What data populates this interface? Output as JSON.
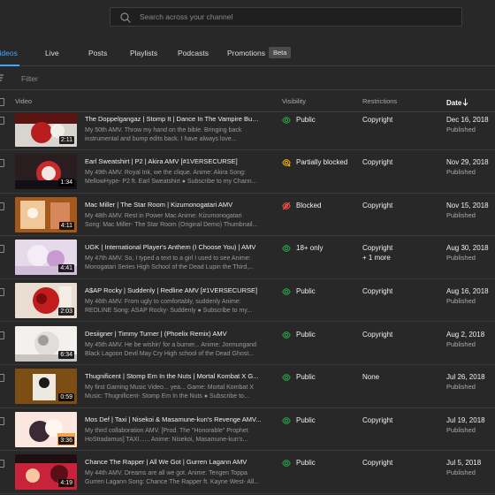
{
  "search": {
    "placeholder": "Search across your channel"
  },
  "tabs": [
    {
      "label": "Videos",
      "active": true
    },
    {
      "label": "Live"
    },
    {
      "label": "Posts"
    },
    {
      "label": "Playlists"
    },
    {
      "label": "Podcasts"
    },
    {
      "label": "Promotions",
      "badge": "Beta"
    }
  ],
  "filter": {
    "placeholder": "Filter"
  },
  "columns": {
    "video": "Video",
    "visibility": "Visibility",
    "restrictions": "Restrictions",
    "date": "Date"
  },
  "colors": {
    "accent": "#3ea6ff",
    "public": "#2ba640",
    "partially_blocked": "#f6b400",
    "blocked": "#ff4e45"
  },
  "rows": [
    {
      "title": "The Doppelgangaz | Stomp It | Dance In The Vampire Bundle",
      "desc1": "My 50th AMV. Throw my hand on the bible. Bringing back",
      "desc2": "instrumental and bump edits back. I have always love...",
      "duration": "2:11",
      "visibility": "Public",
      "vis_icon": "eye-icon",
      "restriction": "Copyright",
      "restriction2": "",
      "date": "Dec 16, 2018",
      "status": "Published"
    },
    {
      "title": "Earl Sweatshirt | P2 | Akira AMV [#1VERSECURSE]",
      "desc1": "My 49th AMV. Royal Ink, we the clique. Anime: Akira Song:",
      "desc2": "MellowHype- P2 ft. Earl Sweatshirt ● Subscribe to my Chann...",
      "duration": "1:34",
      "visibility": "Partially blocked",
      "vis_icon": "eye-partial-icon",
      "restriction": "Copyright",
      "restriction2": "",
      "date": "Nov 29, 2018",
      "status": "Published"
    },
    {
      "title": "Mac Miller | The Star Room | Kizumonogatari AMV",
      "desc1": "My 48th AMV. Rest in Power Mac Anime: Kizumonogatari",
      "desc2": "Song: Mac Miller- The Star Room (Original Demo) Thumbnail...",
      "duration": "4:11",
      "visibility": "Blocked",
      "vis_icon": "eye-off-icon",
      "restriction": "Copyright",
      "restriction2": "",
      "date": "Nov 15, 2018",
      "status": "Published"
    },
    {
      "title": "UGK | International Player's Anthem (I Choose You) | AMV",
      "desc1": "My 47th AMV. So, I typed a text to a girl I used to see Anime:",
      "desc2": "Monogatari Series High School of the Dead Lupin the Third,...",
      "duration": "4:41",
      "visibility": "18+ only",
      "vis_icon": "eye-icon",
      "restriction": "Copyright",
      "restriction2": "+ 1 more",
      "date": "Aug 30, 2018",
      "status": "Published"
    },
    {
      "title": "A$AP Rocky | Suddenly | Redline AMV [#1VERSECURSE]",
      "desc1": "My 46th AMV. From ugly to comfortably, suddenly Anime:",
      "desc2": "REDLINE Song: ASAP Rocky- Suddenly ● Subscribe to my...",
      "duration": "2:03",
      "visibility": "Public",
      "vis_icon": "eye-icon",
      "restriction": "Copyright",
      "restriction2": "",
      "date": "Aug 16, 2018",
      "status": "Published"
    },
    {
      "title": "Desiigner | Timmy Turner | (Phoelix Remix) AMV",
      "desc1": "My 45th AMV. He be wishin' for a burner... Anime: Jormungand",
      "desc2": "Black Lagoon Devil May Cry High school of the Dead Ghost...",
      "duration": "6:34",
      "visibility": "Public",
      "vis_icon": "eye-icon",
      "restriction": "Copyright",
      "restriction2": "",
      "date": "Aug 2, 2018",
      "status": "Published"
    },
    {
      "title": "Thugnificent | Stomp Em In the Nuts | Mortal Kombat X G...",
      "desc1": "My first Gaming Music Video... yea... Game: Mortal Kombat X",
      "desc2": "Music: Thugnificent- Stomp Em In the Nuts ● Subscribe to...",
      "duration": "0:59",
      "visibility": "Public",
      "vis_icon": "eye-icon",
      "restriction": "None",
      "restriction2": "",
      "date": "Jul 26, 2018",
      "status": "Published"
    },
    {
      "title": "Mos Def | Taxi | Nisekoi & Masamune-kun's Revenge AMV...",
      "desc1": "My third collaboration AMV. [Prod. The \"Honorable\" Prophet",
      "desc2": "HoStradamus] TAXI...... Anime: Nisekoi, Masamune-kun's...",
      "duration": "3:36",
      "visibility": "Public",
      "vis_icon": "eye-icon",
      "restriction": "Copyright",
      "restriction2": "",
      "date": "Jul 19, 2018",
      "status": "Published"
    },
    {
      "title": "Chance The Rapper | All We Got | Gurren Lagann AMV",
      "desc1": "My 44th AMV. Dreams are all we got. Anime: Tengen Toppa",
      "desc2": "Gurren Lagann Song: Chance The Rapper ft. Kayne West- All...",
      "duration": "4:19",
      "visibility": "Public",
      "vis_icon": "eye-icon",
      "restriction": "Copyright",
      "restriction2": "",
      "date": "Jul 5, 2018",
      "status": "Published"
    }
  ]
}
